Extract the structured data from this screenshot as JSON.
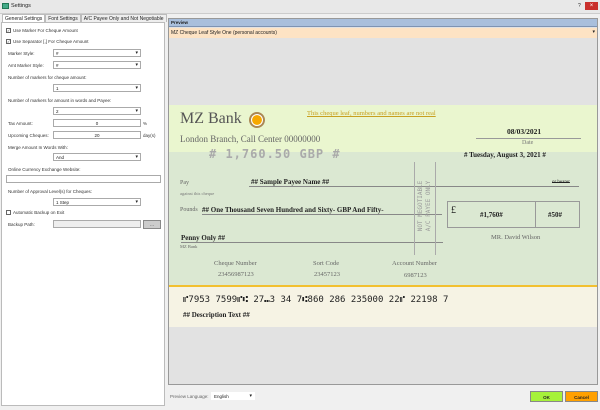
{
  "window": {
    "title": "Settings",
    "help": "?",
    "close": "×"
  },
  "tabs": [
    "General Settings",
    "Font Settings",
    "A/C Payee Only and Not Negotiable"
  ],
  "general": {
    "use_marker": {
      "label": "Use Marker For Cheque Amount",
      "checked": true
    },
    "use_separator": {
      "label": "Use Separator [,] For Cheque Amount",
      "checked": true
    },
    "marker_style": {
      "label": "Marker Style:",
      "value": "#"
    },
    "amt_marker_style": {
      "label": "Amt Marker Style:",
      "value": "#"
    },
    "num_markers_amount": {
      "label": "Number of markers for cheque amount:",
      "value": "1"
    },
    "num_markers_words": {
      "label": "Number of markers for amount in words and Payee:",
      "value": "2"
    },
    "tax_amount": {
      "label": "Tax Amount:",
      "value": "0",
      "unit": "%"
    },
    "upcoming": {
      "label": "Upcoming Cheques:",
      "value": "20",
      "unit": "day(s)"
    },
    "merge": {
      "label": "Merge Amount In Words With:",
      "value": "And"
    },
    "exchange": {
      "label": "Online Currency Exchange Website:",
      "value": ""
    },
    "approval": {
      "label": "Number of Approval Level(s) for Cheques:",
      "value": "1 Step"
    },
    "auto_backup": {
      "label": "Automatic Backup on Exit",
      "checked": false
    },
    "backup_path": {
      "label": "Backup Path:",
      "value": "",
      "browse": "..."
    }
  },
  "preview": {
    "header": "Preview",
    "style": "MZ Cheque Leaf Style One (personal accounts)"
  },
  "cheque": {
    "bank": "MZ Bank",
    "branch": "London Branch, Call Center 00000000",
    "notice": "This cheque leaf, numbers and names are not real",
    "date": "08/03/2021",
    "date_label": "Date",
    "date_long": "# Tuesday, August 3, 2021 #",
    "amount_big": "# 1,760.50 GBP #",
    "pay": "Pay",
    "against": "against this cheque",
    "payee": "## Sample Payee Name ##",
    "bearer": "or bearer",
    "pounds": "Pounds",
    "words1": "## One Thousand Seven Hundred and Sixty- GBP And Fifty-",
    "words2": "Penny Only ##",
    "bank_small": "MZ Bank",
    "stamp1": "NOT NEGOTIABLE",
    "stamp2": "A/C PAYEE ONLY",
    "currency": "£",
    "amount": "#1,760#",
    "pence": "#50#",
    "signer": "MR. David Wilson",
    "cheque_number_label": "Cheque Number",
    "cheque_number": "23456987123",
    "sort_code_label": "Sort Code",
    "sort_code": "23457123",
    "account_label": "Account Number",
    "account": "6987123",
    "micr": "⑈7953 7599⑈⑆ 27⑉3 34 7⑆860 286 235000 22⑈ 22198 7",
    "description": "## Description Text ##"
  },
  "footer": {
    "language_label": "Preview Language:",
    "language": "English",
    "ok": "OK",
    "cancel": "Cancel"
  },
  "colors": {
    "ok": "#a6f23a",
    "cancel": "#ffa000",
    "cheque_top": "#eaf6cf",
    "cheque_body": "#dbe8d2",
    "gold": "#f2c030"
  }
}
